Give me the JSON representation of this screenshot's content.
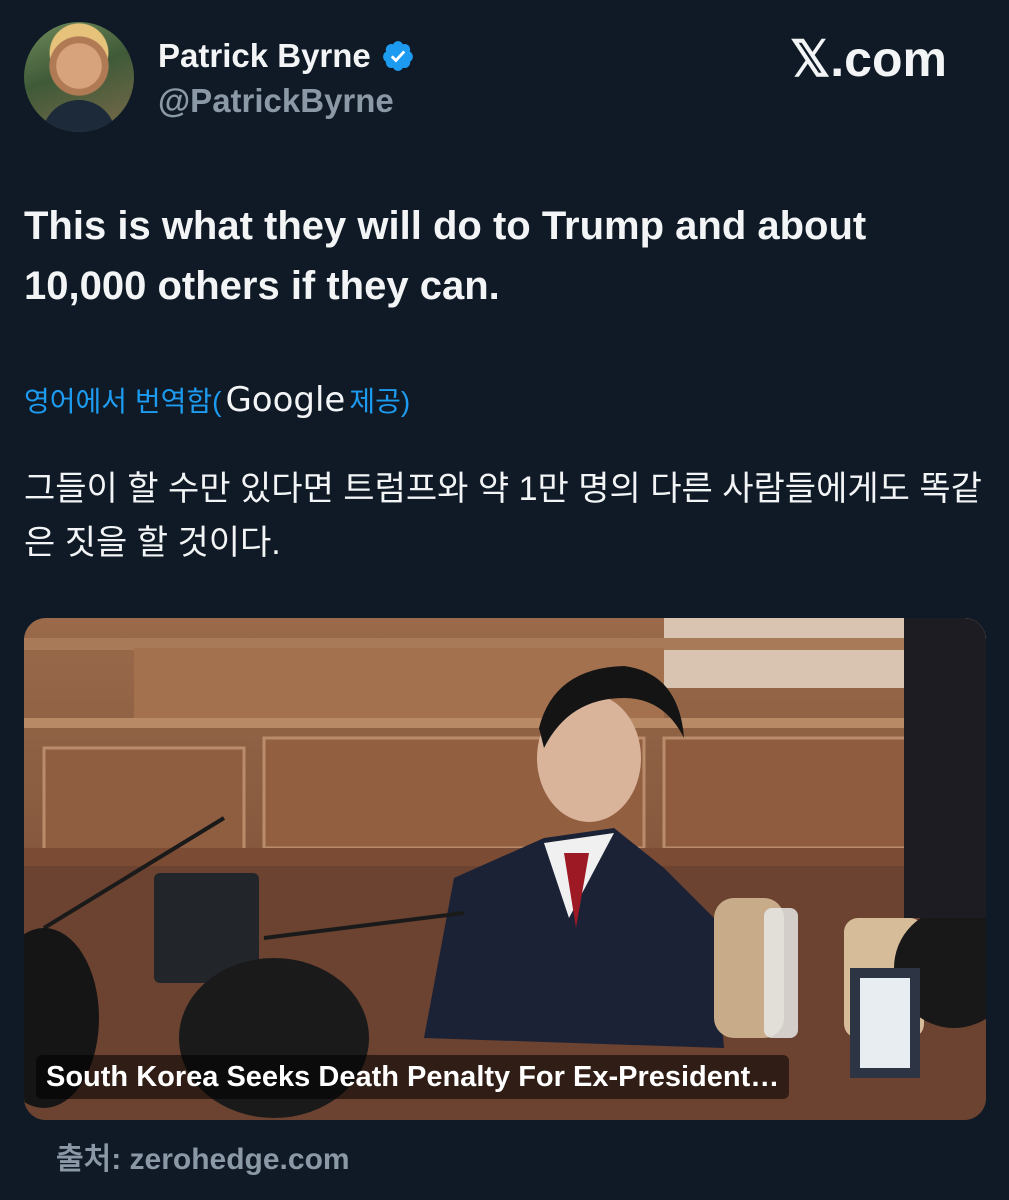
{
  "author": {
    "display_name": "Patrick Byrne",
    "handle": "@PatrickByrne",
    "verified": true,
    "avatar_icon": "profile-photo"
  },
  "brand": {
    "logo_text": "𝕏.com"
  },
  "tweet": {
    "text": "This is what they will do to Trump and about 10,000 others if they can."
  },
  "translation": {
    "label_prefix": "영어에서 번역함(",
    "provider": "Google",
    "label_suffix": " 제공)",
    "text": "그들이 할 수만 있다면 트럼프와 약 1만 명의 다른 사람들에게도 똑같은 짓을 할 것이다."
  },
  "link_card": {
    "title": "South Korea Seeks Death Penalty For Ex-President…",
    "source": "출처: zerohedge.com"
  },
  "colors": {
    "background": "#0f1a26",
    "accent": "#1d9bf0",
    "muted": "#8b98a5"
  }
}
